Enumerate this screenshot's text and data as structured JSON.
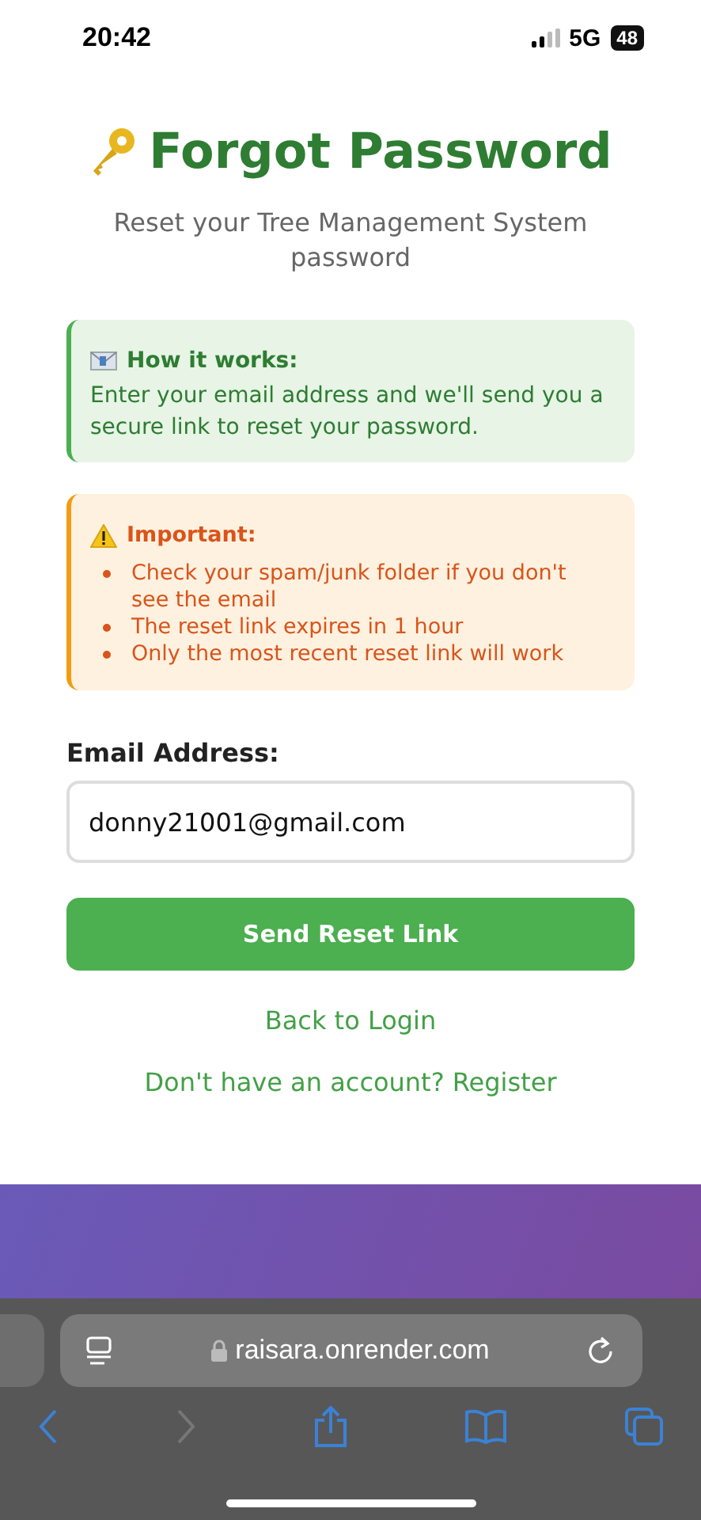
{
  "status_bar": {
    "time": "20:42",
    "network": "5G",
    "battery": "48"
  },
  "title": "Forgot Password",
  "subtitle": "Reset your Tree Management System password",
  "info_box": {
    "heading": "How it works:",
    "text": "Enter your email address and we'll send you a secure link to reset your password."
  },
  "warning_box": {
    "heading": "Important:",
    "items": [
      "Check your spam/junk folder if you don't see the email",
      "The reset link expires in 1 hour",
      "Only the most recent reset link will work"
    ]
  },
  "email_field": {
    "label": "Email Address:",
    "value": "donny21001@gmail.com"
  },
  "submit_button": "Send Reset Link",
  "links": [
    "Back to Login",
    "Don't have an account? Register"
  ],
  "browser": {
    "url": "raisara.onrender.com",
    "forward_disabled": true
  }
}
